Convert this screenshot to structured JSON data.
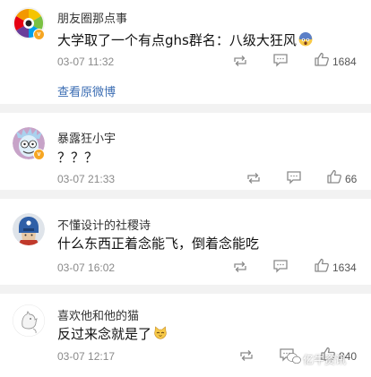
{
  "comments": [
    {
      "username": "朋友圈那点事",
      "content": "大学取了一个有点ghs群名：八级大狂风",
      "time": "03-07 11:32",
      "likes": "1684",
      "link": "查看原微博",
      "verified_badge": "v",
      "trailing_emoji": "scared-face"
    },
    {
      "username": "暴露狂小宇",
      "content": "？？？",
      "time": "03-07 21:33",
      "likes": "66",
      "verified_badge": "v"
    },
    {
      "username": "不懂设计的社稷诗",
      "content": "什么东西正着念能飞，倒着念能吃",
      "time": "03-07 16:02",
      "likes": "1634"
    },
    {
      "username": "喜欢他和他的猫",
      "content": "反过来念就是了",
      "time": "03-07 12:17",
      "likes": "840",
      "trailing_emoji": "cat-face"
    }
  ],
  "watermark": "亿牛资讯",
  "colors": {
    "text": "#111111",
    "username": "#333333",
    "meta": "#8a8a8a",
    "link": "#3b6db3",
    "separator": "#f2f2f2",
    "badge": "#f6a623"
  }
}
